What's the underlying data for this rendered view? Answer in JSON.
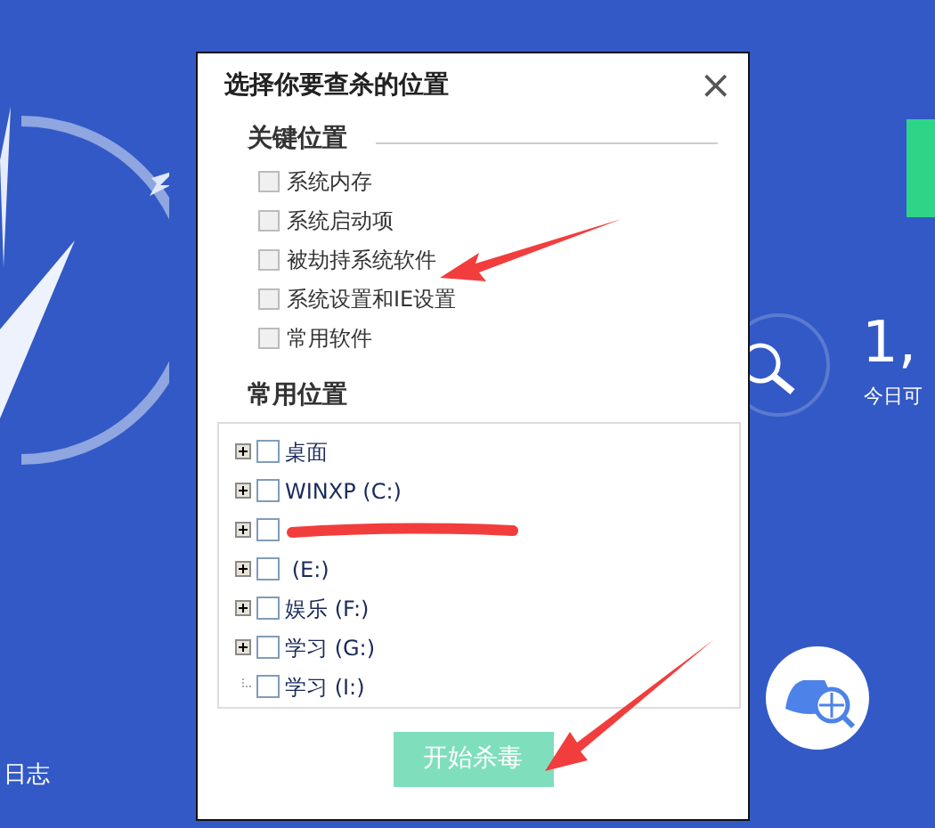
{
  "background": {
    "log_label": "日志",
    "stat_value": "1,",
    "stat_caption": "今日可"
  },
  "dialog": {
    "title": "选择你要查杀的位置",
    "close": "×",
    "key_section": {
      "heading": "关键位置",
      "items": [
        {
          "label": "系统内存",
          "checked": false
        },
        {
          "label": "系统启动项",
          "checked": false
        },
        {
          "label": "被劫持系统软件",
          "checked": false
        },
        {
          "label": "系统设置和IE设置",
          "checked": false
        },
        {
          "label": "常用软件",
          "checked": false
        }
      ]
    },
    "common_section": {
      "heading": "常用位置",
      "tree": [
        {
          "kind": "node",
          "label": "桌面",
          "expandable": true,
          "checked": false
        },
        {
          "kind": "node",
          "label": "WINXP (C:)",
          "expandable": true,
          "checked": false
        },
        {
          "kind": "redacted",
          "expandable": true,
          "checked": false
        },
        {
          "kind": "node",
          "label": " (E:)",
          "expandable": true,
          "checked": false
        },
        {
          "kind": "node",
          "label": "娱乐 (F:)",
          "expandable": true,
          "checked": false
        },
        {
          "kind": "node",
          "label": "学习 (G:)",
          "expandable": true,
          "checked": false
        },
        {
          "kind": "node",
          "label": "学习 (I:)",
          "expandable": false,
          "checked": false
        }
      ]
    },
    "start_button": "开始杀毒"
  }
}
